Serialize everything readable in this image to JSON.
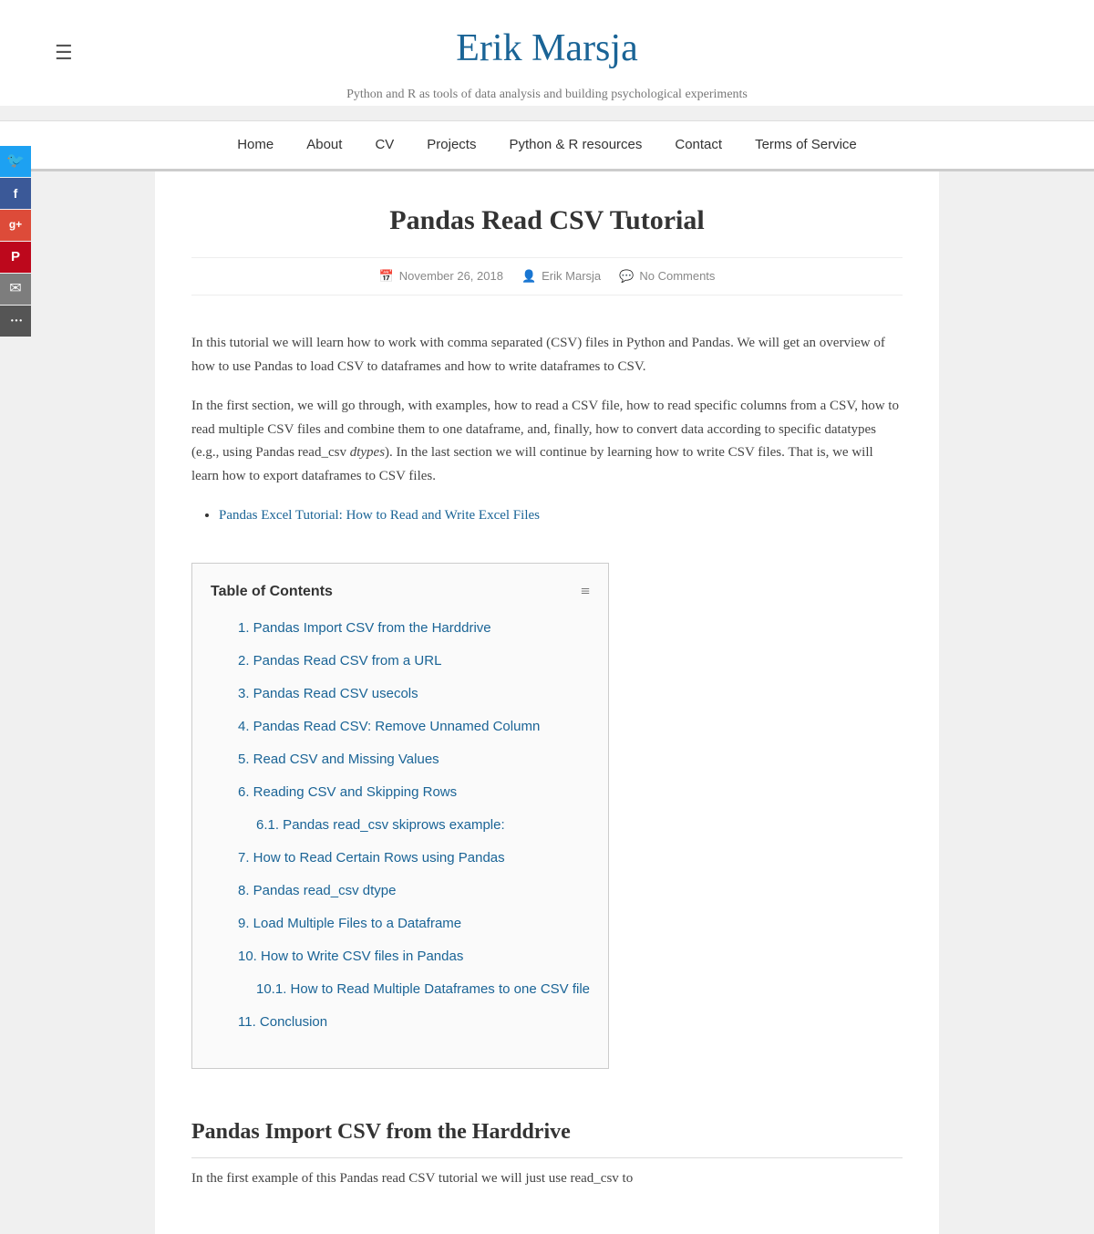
{
  "site": {
    "title": "Erik Marsja",
    "description": "Python and R as tools of data analysis and building psychological experiments",
    "menu_icon": "☰"
  },
  "nav": {
    "items": [
      {
        "label": "Home",
        "href": "#"
      },
      {
        "label": "About",
        "href": "#"
      },
      {
        "label": "CV",
        "href": "#"
      },
      {
        "label": "Projects",
        "href": "#"
      },
      {
        "label": "Python & R resources",
        "href": "#"
      },
      {
        "label": "Contact",
        "href": "#"
      },
      {
        "label": "Terms of Service",
        "href": "#"
      }
    ]
  },
  "social": {
    "items": [
      {
        "name": "twitter",
        "icon": "🐦",
        "class": "social-twitter"
      },
      {
        "name": "facebook",
        "icon": "f",
        "class": "social-facebook"
      },
      {
        "name": "google",
        "icon": "g+",
        "class": "social-google"
      },
      {
        "name": "pinterest",
        "icon": "P",
        "class": "social-pinterest"
      },
      {
        "name": "email",
        "icon": "✉",
        "class": "social-email"
      },
      {
        "name": "more",
        "icon": "⋯",
        "class": "social-more"
      }
    ]
  },
  "article": {
    "title": "Pandas Read CSV Tutorial",
    "date": "November 26, 2018",
    "author": "Erik Marsja",
    "comments": "No Comments",
    "intro1": "In this tutorial we will learn how to work with comma separated (CSV) files in Python and Pandas. We will get an overview of how to use Pandas to load CSV to dataframes and how to write dataframes to CSV.",
    "intro2_part1": "In the first section, we will go through, with examples, how to read a CSV file, how to read specific columns from a CSV, how to read multiple CSV files and combine them to one dataframe, and, finally, how to convert data according to specific datatypes (e.g., using Pandas read_csv ",
    "intro2_italic": "dtypes",
    "intro2_part2": "). In the last section we will continue by learning how to write CSV files. That is, we will learn how to export dataframes to CSV files.",
    "related_link": "Pandas Excel Tutorial: How to Read and Write Excel Files",
    "toc_title": "Table of Contents",
    "toc_items": [
      {
        "num": "1.",
        "label": "Pandas Import CSV from the Harddrive",
        "sub": false
      },
      {
        "num": "2.",
        "label": "Pandas Read CSV from a URL",
        "sub": false
      },
      {
        "num": "3.",
        "label": "Pandas Read CSV usecols",
        "sub": false
      },
      {
        "num": "4.",
        "label": "Pandas Read CSV: Remove Unnamed Column",
        "sub": false
      },
      {
        "num": "5.",
        "label": "Read CSV and Missing Values",
        "sub": false
      },
      {
        "num": "6.",
        "label": "Reading CSV and Skipping Rows",
        "sub": false
      },
      {
        "num": "6.1.",
        "label": "Pandas read_csv skiprows example:",
        "sub": true
      },
      {
        "num": "7.",
        "label": "How to Read Certain Rows using Pandas",
        "sub": false
      },
      {
        "num": "8.",
        "label": "Pandas read_csv dtype",
        "sub": false
      },
      {
        "num": "9.",
        "label": "Load Multiple Files to a Dataframe",
        "sub": false
      },
      {
        "num": "10.",
        "label": "How to Write CSV files in Pandas",
        "sub": false
      },
      {
        "num": "10.1.",
        "label": "How to Read Multiple Dataframes to one CSV file",
        "sub": true
      },
      {
        "num": "11.",
        "label": "Conclusion",
        "sub": false
      }
    ],
    "section1_heading": "Pandas Import CSV from the Harddrive",
    "section1_text": "In the first example of this Pandas read CSV tutorial we will just use read_csv to"
  }
}
